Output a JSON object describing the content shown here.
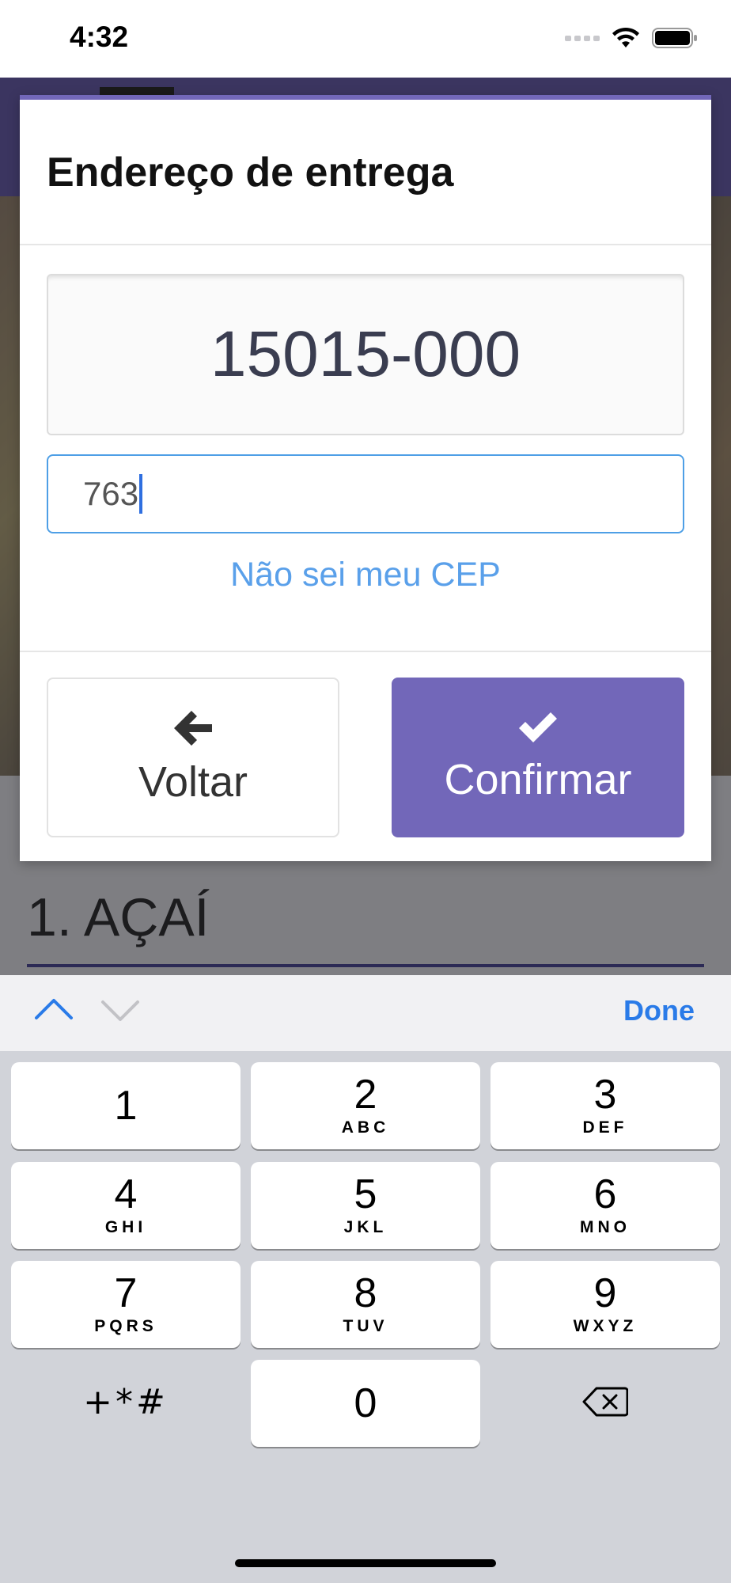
{
  "status_bar": {
    "time": "4:32"
  },
  "background_app": {
    "section_title": "1. AÇAÍ"
  },
  "modal": {
    "title": "Endereço de entrega",
    "cep_value": "15015-000",
    "number_input_value": "763",
    "cep_link": "Não sei meu CEP",
    "back_button": {
      "label": "Voltar",
      "icon": "arrow-left-icon"
    },
    "confirm_button": {
      "label": "Confirmar",
      "icon": "check-icon"
    },
    "accent_color": "#7267b9",
    "link_color": "#5aa0ea"
  },
  "keyboard_toolbar": {
    "done_label": "Done"
  },
  "keyboard": {
    "keys": [
      {
        "num": "1",
        "letters": ""
      },
      {
        "num": "2",
        "letters": "ABC"
      },
      {
        "num": "3",
        "letters": "DEF"
      },
      {
        "num": "4",
        "letters": "GHI"
      },
      {
        "num": "5",
        "letters": "JKL"
      },
      {
        "num": "6",
        "letters": "MNO"
      },
      {
        "num": "7",
        "letters": "PQRS"
      },
      {
        "num": "8",
        "letters": "TUV"
      },
      {
        "num": "9",
        "letters": "WXYZ"
      },
      {
        "num": "0",
        "letters": ""
      }
    ],
    "symbols_key": "+*#",
    "delete_key_icon": "backspace-icon"
  }
}
